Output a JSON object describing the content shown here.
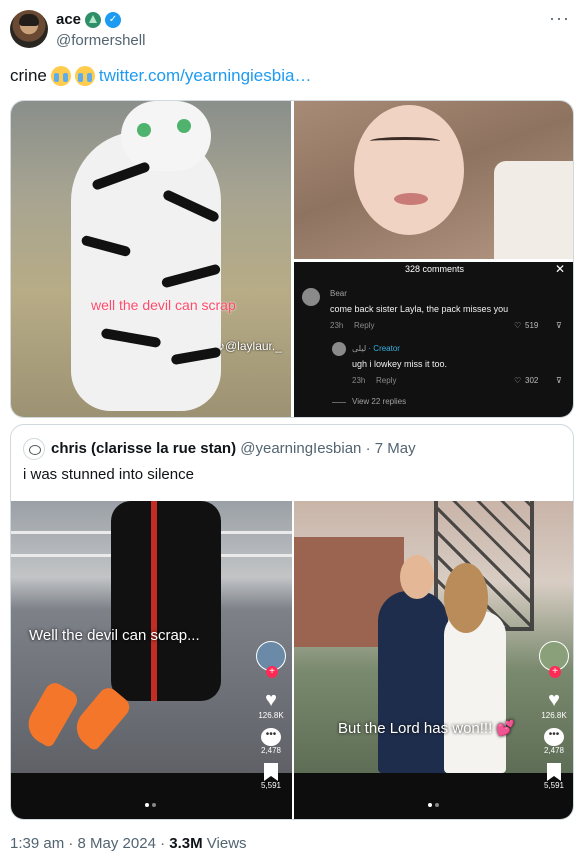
{
  "author": {
    "display_name": "ace",
    "handle": "@formershell",
    "more_label": "···"
  },
  "tweet": {
    "text": "crine",
    "link_text": "twitter.com/yearningiesbia…"
  },
  "media": {
    "fursuit_caption": "well the devil can scrap",
    "tiktok_handle": "♪@laylaur._",
    "comments": {
      "count_label": "328 comments",
      "close": "✕",
      "items": [
        {
          "name": "Bear",
          "text": "come back sister Layla, the pack misses you",
          "time": "23h",
          "reply": "Reply",
          "likes": "519"
        },
        {
          "name": "ليلى",
          "badge": "· Creator",
          "text": "ugh i lowkey miss it too.",
          "time": "23h",
          "reply": "Reply",
          "likes": "302"
        }
      ],
      "view_replies": "View 22 replies"
    }
  },
  "quote": {
    "name": "chris (clarisse la rue stan)",
    "handle": "@yearningIesbian",
    "date": "· 7 May",
    "text": "i was stunned into silence",
    "video1": {
      "caption": "Well the devil can scrap...",
      "likes": "126.8K",
      "comments": "2,478",
      "saves": "5,591"
    },
    "video2": {
      "caption": "But the Lord has won!!! 💕",
      "likes": "126.8K",
      "comments": "2,478",
      "saves": "5,591"
    }
  },
  "meta": {
    "time": "1:39 am · 8 May 2024 ·",
    "views_count": "3.3M",
    "views_label": "Views"
  }
}
